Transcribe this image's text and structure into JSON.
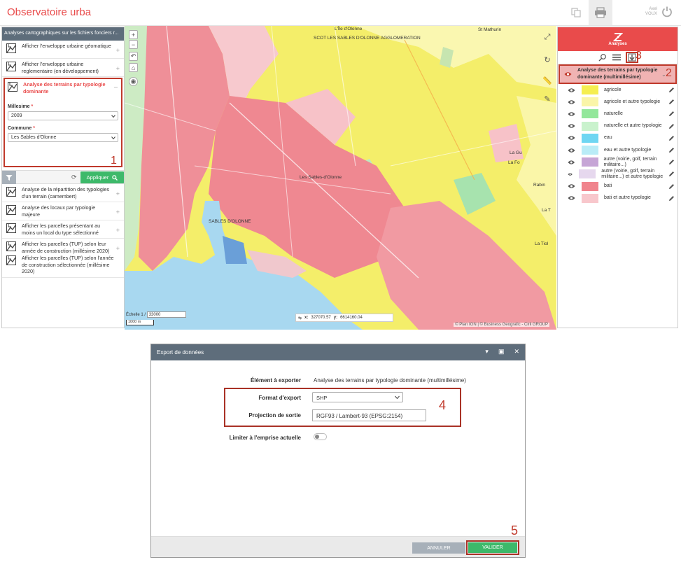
{
  "header": {
    "title": "Observatoire urba",
    "user_first": "Axel",
    "user_last": "VOUX"
  },
  "left_panel": {
    "title": "Analyses cartographiques sur les fichiers fonciers r...",
    "items_top": [
      {
        "label": "Afficher l'enveloppe urbaine géomatique"
      },
      {
        "label": "Afficher l'enveloppe urbaine reglementaire (en développement)"
      }
    ],
    "selected": {
      "label": "Analyse des terrains par typologie dominante",
      "millesime_label": "Millesime",
      "millesime_value": "2009",
      "commune_label": "Commune",
      "commune_value": "Les Sables d'Olonne",
      "marker": "1"
    },
    "apply_label": "Appliquer",
    "items_bottom": [
      {
        "label": "Analyse de la répartition des typologies d'un terrain (camembert)"
      },
      {
        "label": "Analyse des locaux par typologie majeure"
      },
      {
        "label": "Afficher les parcelles présentant au moins un local du type sélectionné"
      },
      {
        "label": "Afficher les parcelles (TUP) selon leur année de construction (millésime 2020)"
      },
      {
        "label": "Afficher les parcelles (TUP) selon l'année de construction sélectionnée (millésime 2020)"
      }
    ]
  },
  "map": {
    "labels": {
      "agglo": "SCOT LES SABLES D'OLONNE AGGLOMERATION",
      "ile": "L'Île d'Olonne",
      "st_mathurin": "St Mathurin",
      "sables": "Les Sables-d'Olonne",
      "sables_centre": "SABLES D'OLONNE",
      "la_gu": "La Gu",
      "la_fo": "La Fo",
      "rabin": "Rabin",
      "la_t": "La T",
      "la_tiol": "La Tiol"
    },
    "scale_label": "Échelle 1 /",
    "scale_value": "33000",
    "scale_bar": "1000 m",
    "coord_x_label": "x:",
    "coord_x": "327070.57",
    "coord_y_label": "y:",
    "coord_y": "6614160.04",
    "attribution": "© Plan IGN | © Business Geografic - Ciril GROUP"
  },
  "right_panel": {
    "title": "Analyses",
    "marker_tools": "3",
    "group_label": "Analyse des terrains par typologie dominante (multimillésime)",
    "marker_group": "2",
    "legend": [
      {
        "label": "agricole",
        "color": "#f5ee50"
      },
      {
        "label": "agricole et autre typologie",
        "color": "#faf5a8"
      },
      {
        "label": "naturelle",
        "color": "#93e79b"
      },
      {
        "label": "naturelle et autre typologie",
        "color": "#c9f2cd"
      },
      {
        "label": "eau",
        "color": "#6fd6f2"
      },
      {
        "label": "eau et autre typologie",
        "color": "#b9ecf7"
      },
      {
        "label": "autre (voirie, golf, terrain militaire...)",
        "color": "#c6a5d6"
      },
      {
        "label": "autre (voirie, golf, terrain militaire...) et autre typologie",
        "color": "#e6d8ee"
      },
      {
        "label": "bati",
        "color": "#f0848d"
      },
      {
        "label": "bati et autre typologie",
        "color": "#f8c7cc"
      }
    ]
  },
  "dialog": {
    "title": "Export de données",
    "element_label": "Élément à exporter",
    "element_value": "Analyse des terrains par typologie dominante (multimillésime)",
    "format_label": "Format d'export",
    "format_value": "SHP",
    "projection_label": "Projection de sortie",
    "projection_value": "RGF93 / Lambert-93 (EPSG:2154)",
    "limit_label": "Limiter à l'emprise actuelle",
    "marker_format": "4",
    "marker_ok": "5",
    "cancel_label": "ANNULER",
    "ok_label": "VALIDER"
  },
  "colors": {
    "accent": "#e94b4b",
    "highlight": "#a93226",
    "green": "#3db96a",
    "header_gray": "#5e6d7b"
  }
}
